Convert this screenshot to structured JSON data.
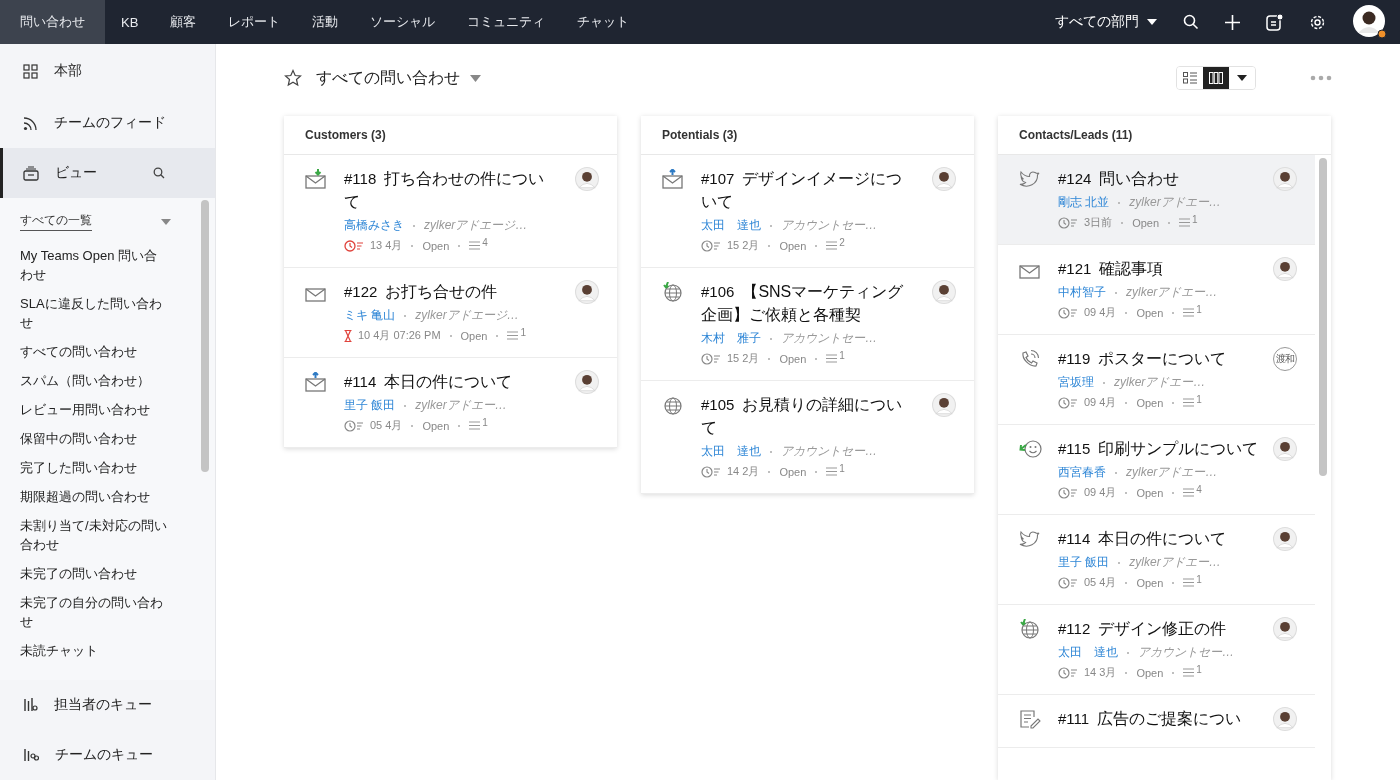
{
  "topbar": {
    "tabs": [
      {
        "label": "問い合わせ",
        "selected": true
      },
      {
        "label": "KB",
        "selected": false
      },
      {
        "label": "顧客",
        "selected": false
      },
      {
        "label": "レポート",
        "selected": false
      },
      {
        "label": "活動",
        "selected": false
      },
      {
        "label": "ソーシャル",
        "selected": false
      },
      {
        "label": "コミュニティ",
        "selected": false
      },
      {
        "label": "チャット",
        "selected": false
      }
    ],
    "department": "すべての部門",
    "notification": true
  },
  "sidebar": {
    "items": [
      {
        "label": "本部",
        "kind": "grid",
        "selected": false
      },
      {
        "label": "チームのフィード",
        "kind": "feed",
        "selected": false
      },
      {
        "label": "ビュー",
        "kind": "views",
        "selected": true
      }
    ],
    "view_list": {
      "title": "すべての一覧",
      "items": [
        "My Teams Open 問い合わせ",
        "SLAに違反した問い合わせ",
        "すべての問い合わせ",
        "スパム（問い合わせ）",
        "レビュー用問い合わせ",
        "保留中の問い合わせ",
        "完了した問い合わせ",
        "期限超過の問い合わせ",
        "未割り当て/未対応の問い合わせ",
        "未完了の問い合わせ",
        "未完了の自分の問い合わせ",
        "未読チャット"
      ]
    },
    "bottom_items": [
      {
        "label": "担当者のキュー",
        "kind": "agent-queue"
      },
      {
        "label": "チームのキュー",
        "kind": "team-queue"
      }
    ]
  },
  "view": {
    "title": "すべての問い合わせ",
    "favorite": false,
    "view_modes": [
      {
        "kind": "list",
        "selected": false
      },
      {
        "kind": "kanban",
        "selected": true
      }
    ]
  },
  "columns": [
    {
      "title": "Customers (3)",
      "tickets": [
        {
          "number": "#118",
          "subject": "打ち合わせの件について",
          "channel": {
            "kind": "email-in"
          },
          "contact": "高橋みさき",
          "account": "zylkerアドエージ…",
          "due": {
            "kind": "overdue"
          },
          "date": "13 4月",
          "status": "Open",
          "threads": "4",
          "avatar": {
            "kind": "photo"
          },
          "selected": false
        },
        {
          "number": "#122",
          "subject": "お打ち合せの件",
          "channel": {
            "kind": "email"
          },
          "contact": "ミキ 亀山",
          "account": "zylkerアドエージ…",
          "due": {
            "kind": "timer"
          },
          "date": "10 4月 07:26 PM",
          "status": "Open",
          "threads": "1",
          "avatar": {
            "kind": "photo"
          },
          "selected": false
        },
        {
          "number": "#114",
          "subject": "本日の件について",
          "channel": {
            "kind": "email-out"
          },
          "contact": "里子 飯田",
          "account": "zylkerアドエー…",
          "due": {
            "kind": "normal"
          },
          "date": "05 4月",
          "status": "Open",
          "threads": "1",
          "avatar": {
            "kind": "photo"
          },
          "selected": false
        }
      ]
    },
    {
      "title": "Potentials (3)",
      "tickets": [
        {
          "number": "#107",
          "subject": "デザインイメージについて",
          "channel": {
            "kind": "email-out"
          },
          "contact": "太田　達也",
          "account": "アカウントセー…",
          "due": {
            "kind": "normal"
          },
          "date": "15 2月",
          "status": "Open",
          "threads": "2",
          "avatar": {
            "kind": "photo"
          },
          "selected": false
        },
        {
          "number": "#106",
          "subject": "【SNSマーケティング企画】ご依頼と各種契",
          "channel": {
            "kind": "web-in"
          },
          "contact": "木村　雅子",
          "account": "アカウントセー…",
          "due": {
            "kind": "normal"
          },
          "date": "15 2月",
          "status": "Open",
          "threads": "1",
          "avatar": {
            "kind": "photo"
          },
          "selected": false
        },
        {
          "number": "#105",
          "subject": "お見積りの詳細について",
          "channel": {
            "kind": "web"
          },
          "contact": "太田　達也",
          "account": "アカウントセー…",
          "due": {
            "kind": "normal"
          },
          "date": "14 2月",
          "status": "Open",
          "threads": "1",
          "avatar": {
            "kind": "photo"
          },
          "selected": false
        }
      ]
    },
    {
      "title": "Contacts/Leads (11)",
      "tickets": [
        {
          "number": "#124",
          "subject": "問い合わせ",
          "channel": {
            "kind": "twitter"
          },
          "contact": "剛志 北並",
          "account": "zylkerアドエー…",
          "due": {
            "kind": "normal"
          },
          "date": "3日前",
          "status": "Open",
          "threads": "1",
          "avatar": {
            "kind": "photo"
          },
          "selected": true
        },
        {
          "number": "#121",
          "subject": "確認事項",
          "channel": {
            "kind": "email"
          },
          "contact": "中村智子",
          "account": "zylkerアドエー…",
          "due": {
            "kind": "normal"
          },
          "date": "09 4月",
          "status": "Open",
          "threads": "1",
          "avatar": {
            "kind": "photo"
          },
          "selected": false
        },
        {
          "number": "#119",
          "subject": "ポスターについて",
          "channel": {
            "kind": "phone"
          },
          "contact": "宮坂理",
          "account": "zylkerアドエー…",
          "due": {
            "kind": "normal"
          },
          "date": "09 4月",
          "status": "Open",
          "threads": "1",
          "avatar": {
            "kind": "initials",
            "initials": "渡和"
          },
          "selected": false
        },
        {
          "number": "#115",
          "subject": "印刷サンプルについて",
          "channel": {
            "kind": "chat-in"
          },
          "contact": "西宮春香",
          "account": "zylkerアドエー…",
          "due": {
            "kind": "normal"
          },
          "date": "09 4月",
          "status": "Open",
          "threads": "4",
          "avatar": {
            "kind": "photo"
          },
          "selected": false
        },
        {
          "number": "#114",
          "subject": "本日の件について",
          "channel": {
            "kind": "twitter"
          },
          "contact": "里子 飯田",
          "account": "zylkerアドエー…",
          "due": {
            "kind": "normal"
          },
          "date": "05 4月",
          "status": "Open",
          "threads": "1",
          "avatar": {
            "kind": "photo"
          },
          "selected": false
        },
        {
          "number": "#112",
          "subject": "デザイン修正の件",
          "channel": {
            "kind": "web-in"
          },
          "contact": "太田　達也",
          "account": "アカウントセー…",
          "due": {
            "kind": "normal"
          },
          "date": "14 3月",
          "status": "Open",
          "threads": "1",
          "avatar": {
            "kind": "photo"
          },
          "selected": false
        },
        {
          "number": "#111",
          "subject": "広告のご提案につい",
          "channel": {
            "kind": "form"
          },
          "avatar": {
            "kind": "photo"
          },
          "selected": false
        }
      ]
    }
  ]
}
